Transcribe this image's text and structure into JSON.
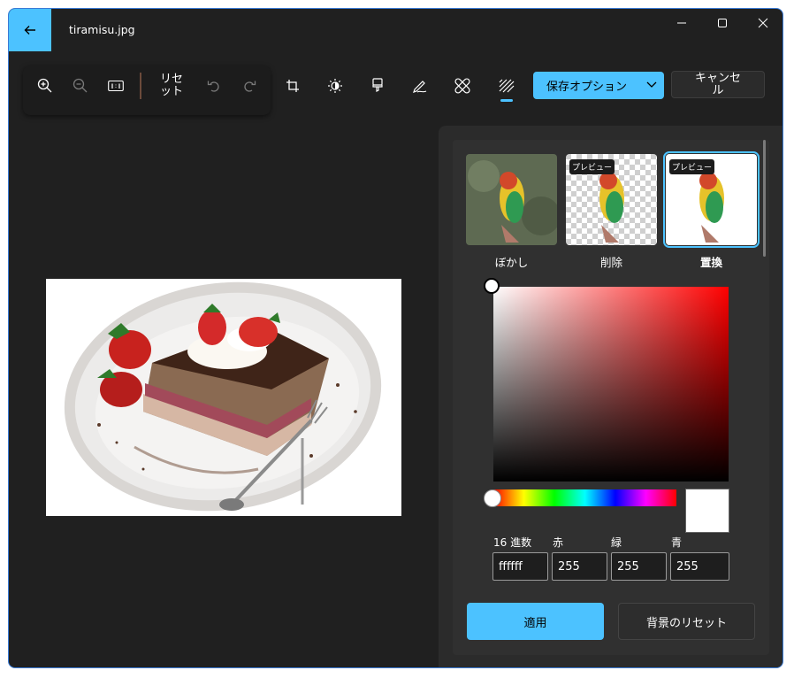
{
  "window": {
    "title": "tiramisu.jpg"
  },
  "toolbar": {
    "reset_label": "リセット",
    "save_options_label": "保存オプション",
    "cancel_label": "キャンセル"
  },
  "background_panel": {
    "options": [
      {
        "label": "ぼかし",
        "preview_badge": ""
      },
      {
        "label": "削除",
        "preview_badge": "プレビュー"
      },
      {
        "label": "置換",
        "preview_badge": "プレビュー"
      }
    ],
    "selected": "置換",
    "color": {
      "hex_label": "16 進数",
      "red_label": "赤",
      "green_label": "緑",
      "blue_label": "青",
      "hex": "ffffff",
      "red": "255",
      "green": "255",
      "blue": "255",
      "swatch": "#ffffff"
    },
    "apply_label": "適用",
    "reset_background_label": "背景のリセット"
  },
  "colors": {
    "accent": "#4cc2ff",
    "window_bg": "#202020",
    "panel_bg": "#2b2b2b"
  }
}
